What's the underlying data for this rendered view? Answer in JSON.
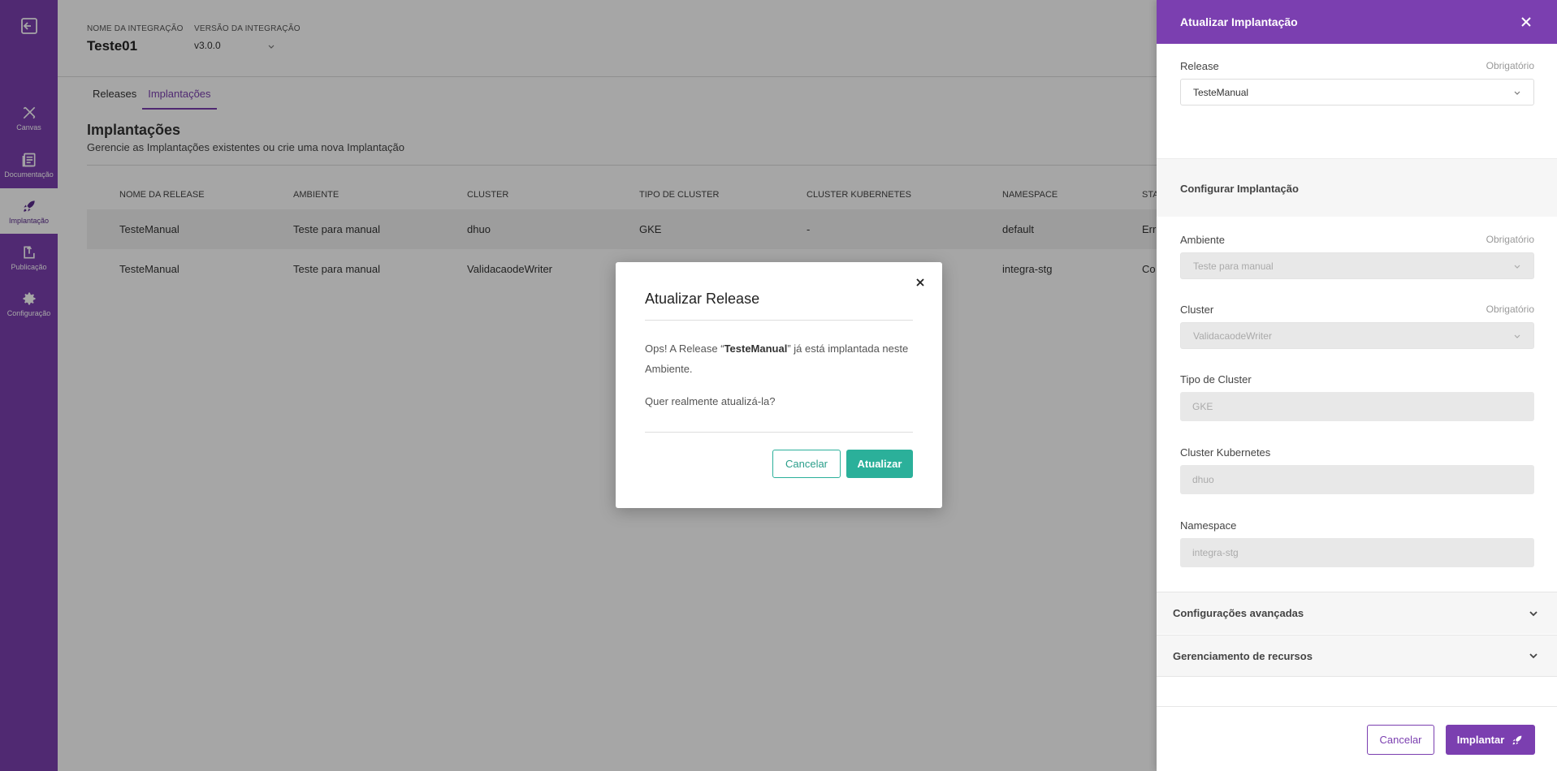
{
  "sidebar": {
    "items": [
      {
        "label": "Canvas",
        "icon": "tools-icon"
      },
      {
        "label": "Documentação",
        "icon": "book-icon"
      },
      {
        "label": "Implantação",
        "icon": "rocket-icon"
      },
      {
        "label": "Publicação",
        "icon": "publish-icon"
      },
      {
        "label": "Configuração",
        "icon": "gear-icon"
      }
    ],
    "active": "Implantação"
  },
  "header": {
    "name_label": "NOME DA INTEGRAÇÃO",
    "name_value": "Teste01",
    "version_label": "VERSÃO DA INTEGRAÇÃO",
    "version_value": "v3.0.0"
  },
  "tabs": [
    {
      "label": "Releases"
    },
    {
      "label": "Implantações"
    }
  ],
  "section": {
    "title": "Implantações",
    "subtitle": "Gerencie as Implantações existentes ou crie uma nova Implantação"
  },
  "table": {
    "columns": [
      "NOME DA RELEASE",
      "AMBIENTE",
      "CLUSTER",
      "TIPO DE CLUSTER",
      "CLUSTER KUBERNETES",
      "NAMESPACE",
      "STA"
    ],
    "rows": [
      [
        "TesteManual",
        "Teste para manual",
        "dhuo",
        "GKE",
        "-",
        "default",
        "Erro"
      ],
      [
        "TesteManual",
        "Teste para manual",
        "ValidacaodeWriter",
        "",
        "",
        "integra-stg",
        "Co"
      ]
    ]
  },
  "panel": {
    "title": "Atualizar Implantação",
    "release_label": "Release",
    "required": "Obrigatório",
    "release_value": "TesteManual",
    "config_title": "Configurar Implantação",
    "ambiente_label": "Ambiente",
    "ambiente_value": "Teste para manual",
    "cluster_label": "Cluster",
    "cluster_value": "ValidacaodeWriter",
    "tipo_label": "Tipo de Cluster",
    "tipo_value": "GKE",
    "kube_label": "Cluster Kubernetes",
    "kube_value": "dhuo",
    "namespace_label": "Namespace",
    "namespace_value": "integra-stg",
    "advanced_label": "Configurações avançadas",
    "resources_label": "Gerenciamento de recursos",
    "cancel_label": "Cancelar",
    "deploy_label": "Implantar"
  },
  "modal": {
    "title": "Atualizar Release",
    "msg_prefix": "Ops! A Release “",
    "msg_release": "TesteManual",
    "msg_suffix": "” já está implantada neste Ambiente.",
    "question": "Quer realmente atualizá-la?",
    "cancel_label": "Cancelar",
    "confirm_label": "Atualizar"
  },
  "colors": {
    "brand_purple": "#7b3fb0",
    "accent_teal": "#2bb09a",
    "error_red": "#d9322e",
    "ok_green": "#2e9e5b"
  }
}
